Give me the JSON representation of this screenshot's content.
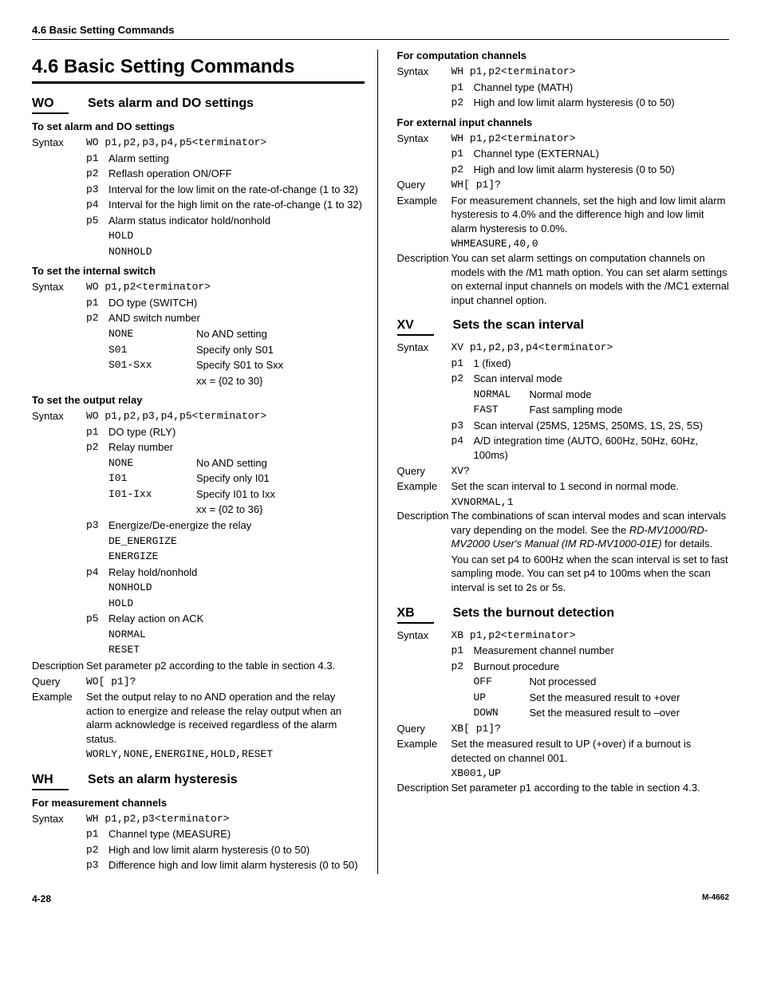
{
  "header": "4.6  Basic Setting Commands",
  "mainTitle": "4.6    Basic Setting Commands",
  "wo": {
    "code": "WO",
    "title": "Sets alarm and DO settings",
    "sec1": {
      "heading": "To set alarm and DO settings",
      "syntax": "WO p1,p2,p3,p4,p5<terminator>",
      "p1": "Alarm setting",
      "p2": "Reflash operation ON/OFF",
      "p3": "Interval for the low limit on the rate-of-change (1 to 32)",
      "p4": "Interval for the high limit on the rate-of-change (1 to 32)",
      "p5": "Alarm status indicator hold/nonhold",
      "p5v1": "HOLD",
      "p5v2": "NONHOLD"
    },
    "sec2": {
      "heading": "To set the internal switch",
      "syntax": "WO p1,p2<terminator>",
      "p1": "DO type (SWITCH)",
      "p2": "AND switch number",
      "r1c1": "NONE",
      "r1c2": "No AND setting",
      "r2c1": "S01",
      "r2c2": "Specify only S01",
      "r3c1": "S01-Sxx",
      "r3c2": "Specify S01 to Sxx",
      "r4c2": "xx = {02 to 30}"
    },
    "sec3": {
      "heading": "To set the output relay",
      "syntax": "WO p1,p2,p3,p4,p5<terminator>",
      "p1": "DO type (RLY)",
      "p2": "Relay number",
      "r1c1": "NONE",
      "r1c2": "No AND setting",
      "r2c1": "I01",
      "r2c2": "Specify only I01",
      "r3c1": "I01-Ixx",
      "r3c2": "Specify I01 to Ixx",
      "r4c2": "xx = {02 to 36}",
      "p3": "Energize/De-energize the relay",
      "p3v1": "DE_ENERGIZE",
      "p3v2": "ENERGIZE",
      "p4": "Relay hold/nonhold",
      "p4v1": "NONHOLD",
      "p4v2": "HOLD",
      "p5": "Relay action on ACK",
      "p5v1": "NORMAL",
      "p5v2": "RESET",
      "desc": "Set parameter p2 according to the table in section 4.3.",
      "query": "WO[ p1]?",
      "example": "Set the output relay to no AND operation and the relay action to energize and release the relay output when an alarm acknowledge is received regardless of the alarm status.",
      "exampleCode": "WORLY,NONE,ENERGINE,HOLD,RESET"
    }
  },
  "wh": {
    "code": "WH",
    "title": "Sets an alarm hysteresis",
    "secM": {
      "heading": "For measurement channels",
      "syntax": "WH p1,p2,p3<terminator>",
      "p1": "Channel type (MEASURE)",
      "p2": "High and low limit alarm hysteresis (0 to 50)",
      "p3": "Difference high and low limit alarm hysteresis (0 to 50)"
    },
    "secC": {
      "heading": "For computation channels",
      "syntax": "WH p1,p2<terminator>",
      "p1": "Channel type (MATH)",
      "p2": "High and low limit alarm hysteresis (0 to 50)"
    },
    "secE": {
      "heading": "For external input channels",
      "syntax": "WH p1,p2<terminator>",
      "p1": "Channel type (EXTERNAL)",
      "p2": "High and low limit alarm hysteresis (0 to 50)",
      "query": "WH[ p1]?",
      "example": "For measurement channels, set the high and low limit alarm hysteresis to 4.0% and the difference high and low limit alarm hysteresis to 0.0%.",
      "exampleCode": "WHMEASURE,40,0",
      "desc": "You can set alarm settings on computation channels on models with the /M1 math option. You can set alarm settings on external input channels on models with the /MC1 external input channel option."
    }
  },
  "xv": {
    "code": "XV",
    "title": "Sets the scan interval",
    "syntax": "XV p1,p2,p3,p4<terminator>",
    "p1": "1 (fixed)",
    "p2": "Scan interval mode",
    "p2r1c1": "NORMAL",
    "p2r1c2": "Normal mode",
    "p2r2c1": "FAST",
    "p2r2c2": "Fast sampling mode",
    "p3": "Scan interval (25MS, 125MS, 250MS, 1S, 2S, 5S)",
    "p4": "A/D integration time (AUTO, 600Hz, 50Hz, 60Hz, 100ms)",
    "query": "XV?",
    "example": "Set the scan interval to 1 second in normal mode.",
    "exampleCode": "XVNORMAL,1",
    "desc1": "The combinations of scan interval modes and scan intervals vary depending on the model. See the ",
    "descItalic": "RD-MV1000/RD-MV2000 User's Manual (IM RD-MV1000-01E)",
    "desc1b": " for details.",
    "desc2": "You can set p4 to 600Hz when the scan interval is set to fast sampling mode. You can set p4 to 100ms when the scan interval is set to 2s or 5s."
  },
  "xb": {
    "code": "XB",
    "title": "Sets the burnout detection",
    "syntax": "XB p1,p2<terminator>",
    "p1": "Measurement channel number",
    "p2": "Burnout procedure",
    "r1c1": "OFF",
    "r1c2": "Not processed",
    "r2c1": "UP",
    "r2c2": "Set the measured result to +over",
    "r3c1": "DOWN",
    "r3c2": "Set the measured result to –over",
    "query": "XB[ p1]?",
    "example": "Set the measured result to UP (+over) if a burnout is detected on channel 001.",
    "exampleCode": "XB001,UP",
    "desc": "Set parameter p1 according to the table in section 4.3."
  },
  "labels": {
    "syntax": "Syntax",
    "query": "Query",
    "example": "Example",
    "description": "Description"
  },
  "footer": {
    "page": "4-28",
    "doc": "M-4662"
  }
}
